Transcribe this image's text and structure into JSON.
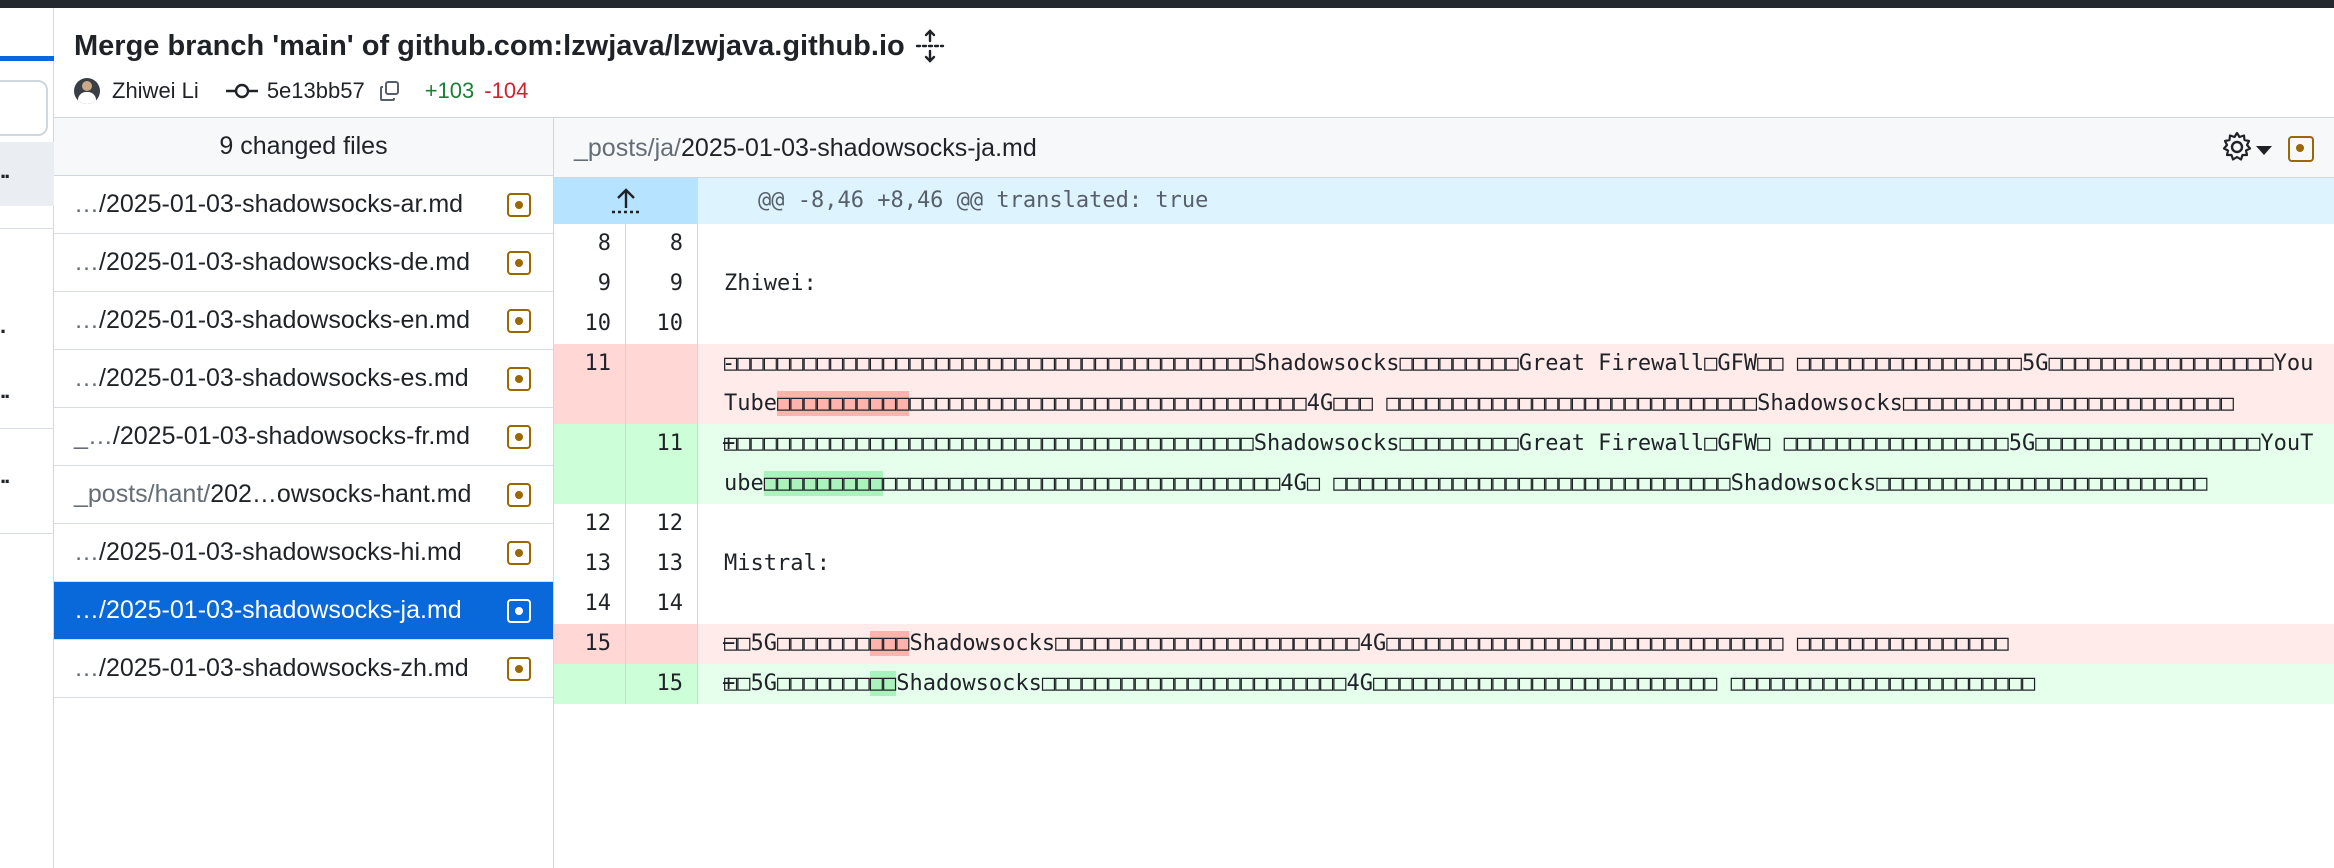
{
  "commit": {
    "title": "Merge branch 'main' of github.com:lzwjava/lzwjava.github.io",
    "author": "Zhiwei Li",
    "sha": "5e13bb57",
    "additions": "+103",
    "deletions": "-104"
  },
  "files": {
    "header": "9 changed files",
    "items": [
      {
        "prefix": "…",
        "name": "/2025-01-03-shadowsocks-ar.md"
      },
      {
        "prefix": "…",
        "name": "/2025-01-03-shadowsocks-de.md"
      },
      {
        "prefix": "…",
        "name": "/2025-01-03-shadowsocks-en.md"
      },
      {
        "prefix": "…",
        "name": "/2025-01-03-shadowsocks-es.md"
      },
      {
        "prefix": "_…",
        "name": "/2025-01-03-shadowsocks-fr.md"
      },
      {
        "prefix": "_posts/hant/",
        "name": "202…owsocks-hant.md"
      },
      {
        "prefix": "…",
        "name": "/2025-01-03-shadowsocks-hi.md"
      },
      {
        "prefix": "…",
        "name": "/2025-01-03-shadowsocks-ja.md"
      },
      {
        "prefix": "…",
        "name": "/2025-01-03-shadowsocks-zh.md"
      }
    ]
  },
  "diff": {
    "path_prefix": "_posts/ja/",
    "path_name": "2025-01-03-shadowsocks-ja.md",
    "hunk": "@@ -8,46 +8,46 @@ translated: true",
    "lines": [
      {
        "old": "8",
        "new": "8",
        "text": ""
      },
      {
        "old": "9",
        "new": "9",
        "text": "Zhiwei:"
      },
      {
        "old": "10",
        "new": "10",
        "text": ""
      },
      {
        "old": "11",
        "new": "",
        "sign": "-",
        "text_a": "□□□□□□□□□□□□□□□□□□□□□□□□□□□□□□□□□□□□□□□□Shadowsocks□□□□□□□□□Great Firewall□GFW□□ □□□□□□□□□□□□□□□□□5G□□□□□□□□□□□□□□□□□YouTube",
        "text_hl": "□□□□□□□□□□",
        "text_b": "□□□□□□□□□□□□□□□□□□□□□□□□□□□□□□4G□□□ □□□□□□□□□□□□□□□□□□□□□□□□□□□□Shadowsocks□□□□□□□□□□□□□□□□□□□□□□□□□"
      },
      {
        "old": "",
        "new": "11",
        "sign": "+",
        "text_a": "□□□□□□□□□□□□□□□□□□□□□□□□□□□□□□□□□□□□□□□□Shadowsocks□□□□□□□□□Great Firewall□GFW□ □□□□□□□□□□□□□□□□□5G□□□□□□□□□□□□□□□□□YouTube",
        "text_hl": "□□□□□□□□□",
        "text_b": "□□□□□□□□□□□□□□□□□□□□□□□□□□□□□□4G□ □□□□□□□□□□□□□□□□□□□□□□□□□□□□□□Shadowsocks□□□□□□□□□□□□□□□□□□□□□□□□□"
      },
      {
        "old": "12",
        "new": "12",
        "text": ""
      },
      {
        "old": "13",
        "new": "13",
        "text": "Mistral:"
      },
      {
        "old": "14",
        "new": "14",
        "text": ""
      },
      {
        "old": "15",
        "new": "",
        "sign": "−",
        "text_a": "□□5G□□□□□□□",
        "text_hl": "□□□",
        "text_b": "Shadowsocks□□□□□□□□□□□□□□□□□□□□□□□4G□□□□□□□□□□□□□□□□□□□□□□□□□□□□□□ □□□□□□□□□□□□□□□□"
      },
      {
        "old": "",
        "new": "15",
        "sign": "+",
        "text_a": "□□5G□□□□□□□",
        "text_hl": "□□",
        "text_b": "Shadowsocks□□□□□□□□□□□□□□□□□□□□□□□4G□□□□□□□□□□□□□□□□□□□□□□□□□□ □□□□□□□□□□□□□□□□□□□□□□□"
      }
    ]
  }
}
